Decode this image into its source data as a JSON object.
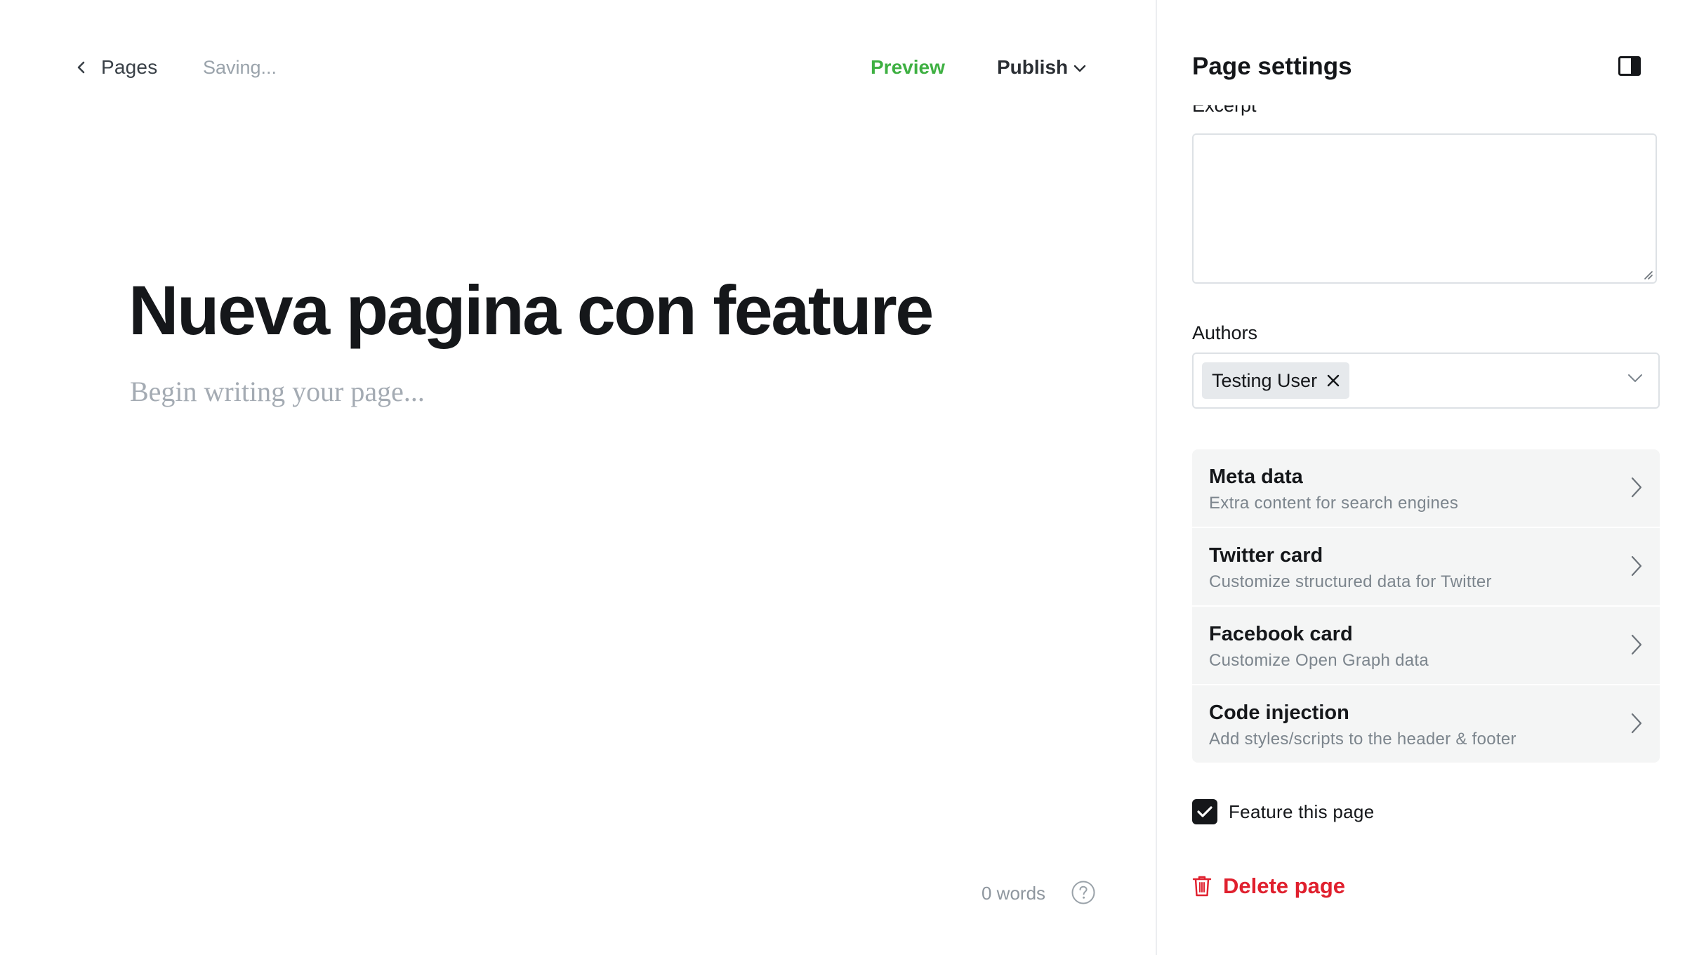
{
  "header": {
    "back_label": "Pages",
    "status": "Saving...",
    "preview_label": "Preview",
    "publish_label": "Publish"
  },
  "editor": {
    "title": "Nueva pagina con feature",
    "body_placeholder": "Begin writing your page...",
    "word_count": "0 words"
  },
  "settings": {
    "title": "Page settings",
    "excerpt_label": "Excerpt",
    "excerpt_value": "",
    "authors_label": "Authors",
    "authors": [
      "Testing User"
    ],
    "nav_items": [
      {
        "title": "Meta data",
        "subtitle": "Extra content for search engines"
      },
      {
        "title": "Twitter card",
        "subtitle": "Customize structured data for Twitter"
      },
      {
        "title": "Facebook card",
        "subtitle": "Customize Open Graph data"
      },
      {
        "title": "Code injection",
        "subtitle": "Add styles/scripts to the header & footer"
      }
    ],
    "feature_label": "Feature this page",
    "feature_checked": true,
    "delete_label": "Delete page"
  },
  "icons": {
    "back": "chevron-left-icon",
    "publish_caret": "chevron-down-icon",
    "help": "question-circle-icon",
    "panel_toggle": "sidebar-toggle-icon",
    "token_remove": "close-icon",
    "select_caret": "chevron-down-icon",
    "nav_arrow": "chevron-right-icon",
    "check": "check-icon",
    "delete": "trash-icon"
  },
  "colors": {
    "accent_green": "#3eb042",
    "danger_red": "#e0202e",
    "text_dark": "#15171a",
    "muted": "#8e969e",
    "panel_item_bg": "#f4f5f5"
  }
}
